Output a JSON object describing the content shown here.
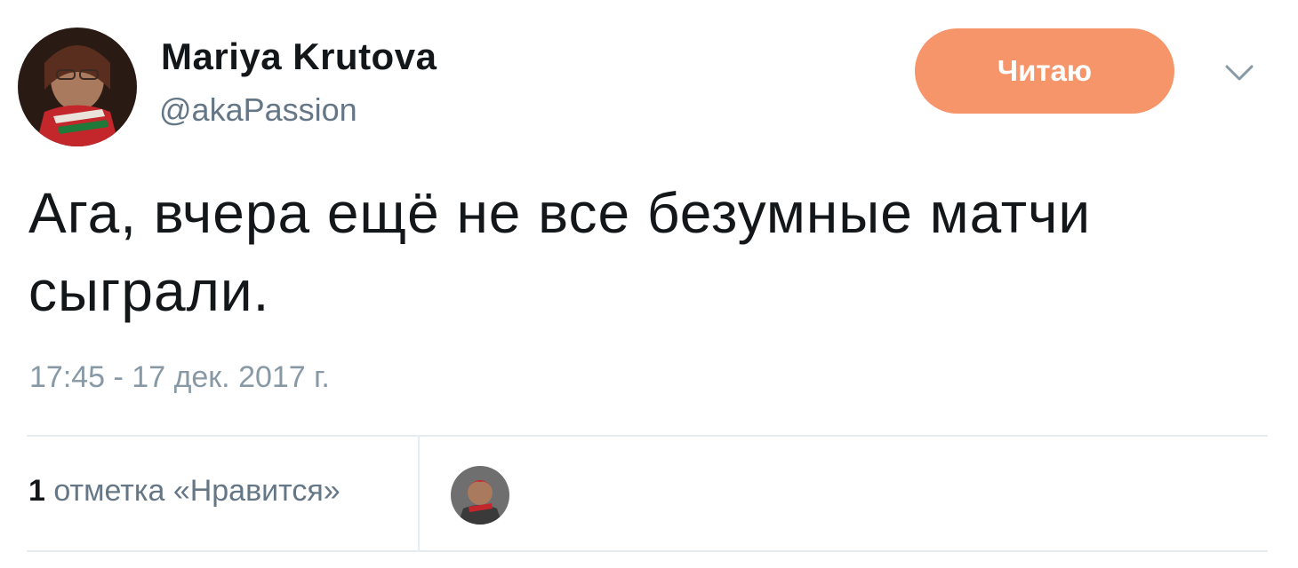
{
  "user": {
    "display_name": "Mariya Krutova",
    "handle": "@akaPassion",
    "avatar_icon": "profile-photo"
  },
  "follow_button": {
    "label": "Читаю",
    "color": "#f7956a"
  },
  "menu_icon": "chevron-down-icon",
  "tweet": {
    "text": "Ага, вчера ещё не все безумные матчи сыграли.",
    "timestamp": "17:45 - 17 дек. 2017 г."
  },
  "stats": {
    "likes_count": "1",
    "likes_label": "отметка «Нравится»"
  },
  "likers": [
    {
      "avatar_icon": "liker-avatar"
    }
  ],
  "colors": {
    "primary_text": "#14171a",
    "secondary_text": "#657786",
    "timestamp_text": "#8899a6",
    "divider": "#e6ecf0"
  }
}
